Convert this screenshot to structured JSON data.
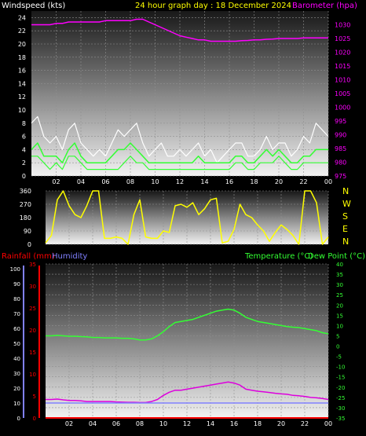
{
  "colors": {
    "wind_axis": "#ffffff",
    "baro_axis": "#ff00ff",
    "title": "#ffff00",
    "dir_line": "#ffff00",
    "rain": "#ff0000",
    "humidity": "#8080ff",
    "temp": "#33ff33",
    "dew": "#dd00dd",
    "gust": "#ffffff",
    "avg_wind": "#33ff33"
  },
  "header": {
    "windspeed_label": "Windspeed (kts)",
    "title": "24 hour graph day : 18 December 2024",
    "barometer_label": "Barometer (hpa)"
  },
  "lower_header": {
    "rainfall_label": "Rainfall (mm)",
    "humidity_label": "Humidity",
    "temperature_label": "Temperature (°C)",
    "dewpoint_label": "Dew Point (°C)"
  },
  "x_ticks": [
    "02",
    "04",
    "06",
    "08",
    "10",
    "12",
    "14",
    "16",
    "18",
    "20",
    "22",
    "00"
  ],
  "chart_data": [
    {
      "type": "line",
      "panel": "wind",
      "x_hours": [
        0,
        0.5,
        1,
        1.5,
        2,
        2.5,
        3,
        3.5,
        4,
        4.5,
        5,
        5.5,
        6,
        6.5,
        7,
        7.5,
        8,
        8.5,
        9,
        9.5,
        10,
        10.5,
        11,
        11.5,
        12,
        12.5,
        13,
        13.5,
        14,
        14.5,
        15,
        15.5,
        16,
        16.5,
        17,
        17.5,
        18,
        18.5,
        19,
        19.5,
        20,
        20.5,
        21,
        21.5,
        22,
        22.5,
        23,
        23.5,
        24
      ],
      "ylim_left": [
        0,
        25
      ],
      "yticks_left": [
        0,
        2,
        4,
        6,
        8,
        10,
        12,
        14,
        16,
        18,
        20,
        22,
        24
      ],
      "ylim_right": [
        975,
        1035
      ],
      "yticks_right": [
        975,
        980,
        985,
        990,
        995,
        1000,
        1005,
        1010,
        1015,
        1020,
        1025,
        1030
      ],
      "series": [
        {
          "axis": "right",
          "values": [
            1030,
            1030,
            1030,
            1030,
            1030.5,
            1030.5,
            1031,
            1031,
            1031,
            1031,
            1031,
            1031,
            1031.5,
            1031.5,
            1031.5,
            1031.5,
            1031.5,
            1032,
            1032,
            1031,
            1030,
            1029,
            1028,
            1027,
            1026,
            1025.5,
            1025,
            1024.5,
            1024.5,
            1024,
            1024,
            1024,
            1024,
            1024,
            1024.2,
            1024.3,
            1024.5,
            1024.5,
            1024.7,
            1024.8,
            1025,
            1025,
            1025,
            1025,
            1025.2,
            1025.2,
            1025.2,
            1025.2,
            1025.2
          ]
        },
        {
          "axis": "left",
          "values": [
            8,
            9,
            6,
            5,
            6,
            4,
            7,
            8,
            5,
            4,
            3,
            4,
            3,
            5,
            7,
            6,
            7,
            8,
            5,
            3,
            4,
            5,
            3,
            3,
            4,
            3,
            4,
            5,
            3,
            4,
            2,
            3,
            4,
            5,
            5,
            3,
            3,
            4,
            6,
            4,
            5,
            5,
            3,
            4,
            6,
            5,
            8,
            7,
            6
          ]
        },
        {
          "axis": "left",
          "values": [
            3,
            3,
            2,
            1,
            2,
            1,
            3,
            3,
            2,
            1,
            1,
            1,
            1,
            1,
            1,
            2,
            3,
            2,
            2,
            1,
            1,
            1,
            1,
            1,
            1,
            1,
            1,
            1,
            1,
            1,
            1,
            1,
            1,
            2,
            2,
            1,
            1,
            2,
            2,
            2,
            3,
            2,
            1,
            1,
            2,
            2,
            2,
            2,
            2
          ]
        },
        {
          "axis": "left",
          "values": [
            4,
            5,
            3,
            3,
            3,
            2,
            4,
            5,
            3,
            2,
            2,
            2,
            2,
            3,
            4,
            4,
            5,
            4,
            3,
            2,
            2,
            2,
            2,
            2,
            2,
            2,
            2,
            3,
            2,
            2,
            2,
            2,
            2,
            3,
            3,
            2,
            2,
            3,
            4,
            3,
            4,
            3,
            2,
            2,
            3,
            3,
            4,
            4,
            4
          ]
        }
      ]
    },
    {
      "type": "line",
      "panel": "direction",
      "x_hours": [
        0,
        0.5,
        1,
        1.5,
        2,
        2.5,
        3,
        3.5,
        4,
        4.5,
        5,
        5.5,
        6,
        6.5,
        7,
        7.5,
        8,
        8.5,
        9,
        9.5,
        10,
        10.5,
        11,
        11.5,
        12,
        12.5,
        13,
        13.5,
        14,
        14.5,
        15,
        15.5,
        16,
        16.5,
        17,
        17.5,
        18,
        18.5,
        19,
        19.5,
        20,
        20.5,
        21,
        21.5,
        22,
        22.5,
        23,
        23.5,
        24
      ],
      "ylim": [
        0,
        360
      ],
      "yticks": [
        0,
        90,
        180,
        270,
        360
      ],
      "compass": [
        "N",
        "W",
        "S",
        "E",
        "N"
      ],
      "values": [
        10,
        60,
        300,
        360,
        260,
        200,
        180,
        260,
        360,
        360,
        40,
        40,
        50,
        40,
        0,
        200,
        300,
        50,
        40,
        40,
        90,
        80,
        260,
        270,
        250,
        280,
        200,
        240,
        300,
        310,
        10,
        20,
        100,
        270,
        200,
        180,
        130,
        90,
        20,
        80,
        130,
        100,
        60,
        0,
        360,
        360,
        280,
        0,
        50
      ]
    },
    {
      "type": "line",
      "panel": "temperature",
      "x_hours": [
        0,
        0.5,
        1,
        1.5,
        2,
        2.5,
        3,
        3.5,
        4,
        4.5,
        5,
        5.5,
        6,
        6.5,
        7,
        7.5,
        8,
        8.5,
        9,
        9.5,
        10,
        10.5,
        11,
        11.5,
        12,
        12.5,
        13,
        13.5,
        14,
        14.5,
        15,
        15.5,
        16,
        16.5,
        17,
        17.5,
        18,
        18.5,
        19,
        19.5,
        20,
        20.5,
        21,
        21.5,
        22,
        22.5,
        23,
        23.5,
        24
      ],
      "ylim_left_rain": [
        0,
        35
      ],
      "yticks_rain": [
        0,
        5,
        10,
        15,
        20,
        25,
        30,
        35
      ],
      "ylim_left_humidity": [
        0,
        100
      ],
      "yticks_humidity": [
        0,
        10,
        20,
        30,
        40,
        50,
        60,
        70,
        80,
        90,
        100
      ],
      "ylim_right": [
        -35,
        40
      ],
      "yticks_right": [
        -35,
        -30,
        -25,
        -20,
        -15,
        -10,
        -5,
        0,
        5,
        10,
        15,
        20,
        25,
        30,
        35,
        40
      ],
      "series": [
        {
          "values": [
            5,
            5,
            5.2,
            5,
            4.8,
            4.8,
            4.6,
            4.5,
            4.2,
            4.2,
            4,
            4,
            4,
            3.8,
            3.8,
            3.5,
            3,
            3,
            3.5,
            5,
            7,
            9.5,
            11.5,
            12,
            12.5,
            13,
            14,
            15,
            16,
            17,
            17.5,
            18,
            17.5,
            16,
            14,
            13,
            12,
            11.5,
            11,
            10.5,
            10,
            9.5,
            9.2,
            9,
            8.5,
            8,
            7.5,
            6.5,
            6
          ]
        },
        {
          "values": [
            -26,
            -26,
            -25.8,
            -26.2,
            -26.5,
            -26.5,
            -26.7,
            -27,
            -27,
            -27,
            -27,
            -27,
            -27.2,
            -27.3,
            -27.4,
            -27.4,
            -27.5,
            -27.5,
            -27,
            -26,
            -24,
            -22.5,
            -21.5,
            -21.5,
            -21,
            -20.5,
            -20,
            -19.5,
            -19,
            -18.5,
            -18,
            -17.5,
            -18,
            -19,
            -21,
            -21.5,
            -22,
            -22.3,
            -22.6,
            -23,
            -23.3,
            -23.5,
            -24,
            -24.2,
            -24.5,
            -25,
            -25.2,
            -25.5,
            -26
          ]
        },
        {
          "values": [
            10,
            10,
            10,
            10,
            10,
            10,
            10,
            10,
            10,
            10,
            10,
            10,
            10,
            10,
            10,
            10,
            10,
            10,
            10,
            10,
            10,
            10,
            10,
            10,
            10,
            10,
            10,
            10,
            10,
            10,
            10,
            10,
            10,
            10,
            10,
            10,
            10,
            10,
            10,
            10,
            10,
            10,
            10,
            10,
            10,
            10,
            10,
            10,
            10
          ]
        },
        {
          "values": [
            0,
            0,
            0,
            0,
            0,
            0,
            0,
            0,
            0,
            0,
            0,
            0,
            0,
            0,
            0,
            0,
            0,
            0,
            0,
            0,
            0,
            0,
            0,
            0,
            0,
            0,
            0,
            0,
            0,
            0,
            0,
            0,
            0,
            0,
            0,
            0,
            0,
            0,
            0,
            0,
            0,
            0,
            0,
            0,
            0,
            0,
            0,
            0,
            0
          ]
        }
      ]
    }
  ]
}
